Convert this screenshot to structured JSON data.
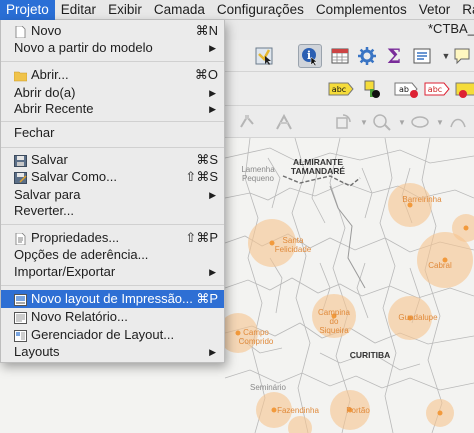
{
  "menubar": {
    "items": [
      "Projeto",
      "Editar",
      "Exibir",
      "Camada",
      "Configurações",
      "Complementos",
      "Vetor",
      "Ras"
    ]
  },
  "window": {
    "title": "*CTBA_T"
  },
  "menu": {
    "items": [
      {
        "label": "Novo",
        "shortcut": "⌘N"
      },
      {
        "label": "Novo a partir do modelo",
        "submenu": "▶"
      },
      {
        "label": "Abrir...",
        "shortcut": "⌘O"
      },
      {
        "label": "Abrir do(a)",
        "submenu": "▶"
      },
      {
        "label": "Abrir Recente",
        "submenu": "▶"
      },
      {
        "label": "Fechar"
      },
      {
        "label": "Salvar",
        "shortcut": "⌘S"
      },
      {
        "label": "Salvar Como...",
        "shortcut": "⇧⌘S"
      },
      {
        "label": "Salvar para",
        "submenu": "▶"
      },
      {
        "label": "Reverter..."
      },
      {
        "label": "Propriedades...",
        "shortcut": "⇧⌘P"
      },
      {
        "label": "Opções de aderência..."
      },
      {
        "label": "Importar/Exportar",
        "submenu": "▶"
      },
      {
        "label": "Novo layout de Impressão...",
        "shortcut": "⌘P"
      },
      {
        "label": "Novo Relatório..."
      },
      {
        "label": "Gerenciador de Layout..."
      },
      {
        "label": "Layouts",
        "submenu": "▶"
      }
    ]
  },
  "toolbar": {
    "sigma": "Σ",
    "label_abc": "abc",
    "label_ab": "ab",
    "label_abc2": "abc"
  },
  "map": {
    "labels": {
      "almirante": "ALMIRANTE\nTAMANDARÉ",
      "curitiba": "CURITIBA",
      "lamenha": "Lamenha\nPequeno",
      "barreirinha": "Barreirinha",
      "santa_felicidade": "Santa\nFelicidade",
      "cabral": "Cabral",
      "guadalupe": "Guadalupe",
      "campina": "Campina\ndo\nSiqueira",
      "campo_comprido": "Campo\nComprido",
      "fazendinha": "Fazendinha",
      "portao": "Portão",
      "seminario": "Seminário"
    },
    "colors": {
      "highlight": "#2e6fd4",
      "circle": "#f7c48f",
      "dot": "#f29a3c"
    }
  }
}
